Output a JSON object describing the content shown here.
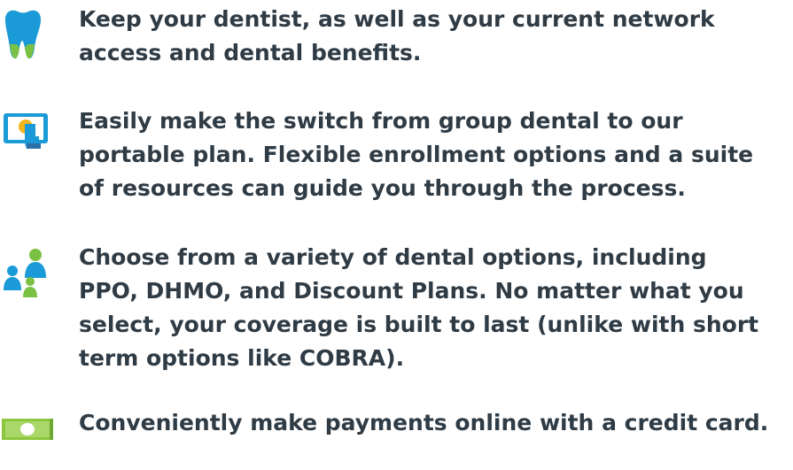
{
  "benefits": {
    "items": [
      {
        "icon": "tooth-icon",
        "lines": [
          "Keep your dentist,  as well as your current network",
          "access and dental benefits."
        ]
      },
      {
        "icon": "tablet-touch-icon",
        "lines": [
          "Easily make the switch  from group dental to our",
          "portable plan. Flexible enrollment options and a suite",
          "of resources can guide you through the process."
        ]
      },
      {
        "icon": "people-group-icon",
        "lines": [
          "Choose from a variety of dental options,  including",
          "PPO, DHMO, and Discount Plans. No matter what you",
          "select, your coverage is built to last (unlike with short",
          "term options like COBRA)."
        ]
      },
      {
        "icon": "cash-bill-icon",
        "lines": [
          "Conveniently make payments  online with a credit card."
        ]
      }
    ]
  },
  "colors": {
    "text": "#2f3b45",
    "tooth_blue": "#1a9ad6",
    "tooth_green": "#7ac143",
    "tablet_blue": "#1a9ad6",
    "tablet_yellow": "#f2b51d",
    "people_blue": "#1a9ad6",
    "people_green": "#7ac143",
    "cash_green": "#8cc63f"
  }
}
